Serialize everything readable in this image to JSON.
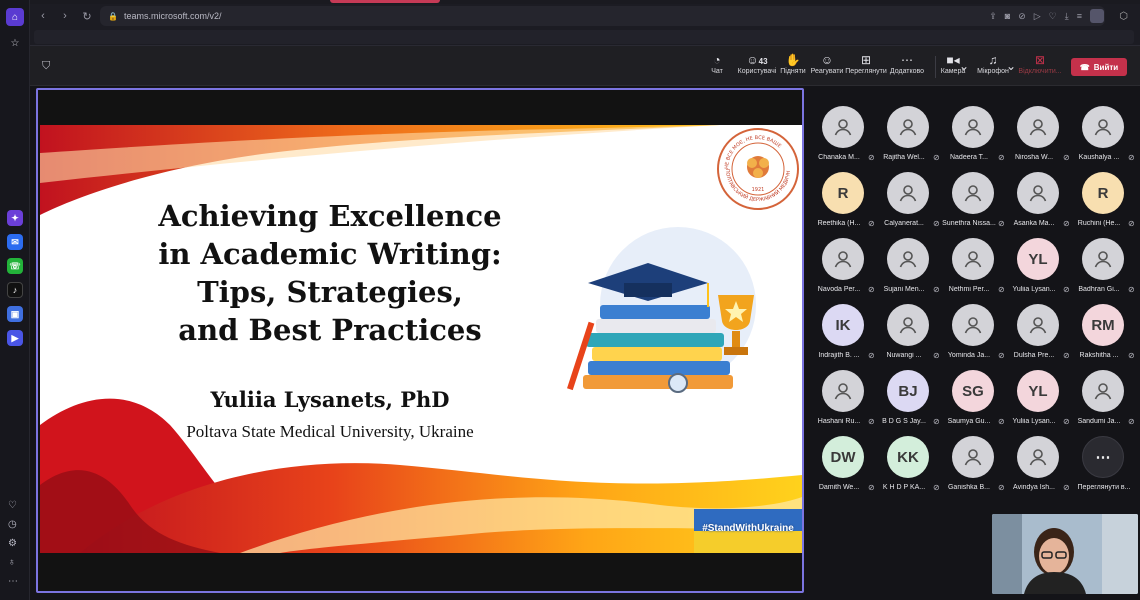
{
  "browser": {
    "url": "teams.microsoft.com/v2/",
    "colors": {
      "accent": "#5a3bd1",
      "tab_active": "#c63a56"
    }
  },
  "toolbar": {
    "chat_label": "Чат",
    "people_label": "Користувачі",
    "people_count": "43",
    "raise_label": "Підняти",
    "react_label": "Реагувати",
    "view_label": "Переглянути",
    "more_label": "Додатково",
    "camera_label": "Камера",
    "mic_label": "Мікрофон",
    "share_label": "Відключити...",
    "leave_label": "Вийти",
    "leave_color": "#c4314b"
  },
  "slide": {
    "title_lines": [
      "Achieving Excellence",
      "in Academic Writing:",
      "Tips, Strategies,",
      "and Best Practices"
    ],
    "author": "Yuliia Lysanets, PhD",
    "affiliation": "Poltava State Medical University, Ukraine",
    "badge": "#StandWithUkraine",
    "seal_text_top": "НЕ ВСЕ МОЄ, НЕ ВСЕ ВАШЕ",
    "seal_year": "1921",
    "seal_text_bottom": "ПОЛТАВСЬКИЙ ДЕРЖАВНИЙ МЕДИЧНИЙ"
  },
  "participants": [
    {
      "name": "Chanaka M...",
      "initials": "",
      "color": ""
    },
    {
      "name": "Rajitha Wel...",
      "initials": "",
      "color": ""
    },
    {
      "name": "Nadeera T...",
      "initials": "",
      "color": ""
    },
    {
      "name": "Nirosha W...",
      "initials": "",
      "color": ""
    },
    {
      "name": "Kaushalya ...",
      "initials": "",
      "color": ""
    },
    {
      "name": "Reethika (H...",
      "initials": "R",
      "color": "#f8dfb0"
    },
    {
      "name": "Calyanerat...",
      "initials": "",
      "color": ""
    },
    {
      "name": "Sunethra Nissa...",
      "initials": "",
      "color": ""
    },
    {
      "name": "Asanka Ma...",
      "initials": "",
      "color": ""
    },
    {
      "name": "Ruchini (He...",
      "initials": "R",
      "color": "#f8dfb0"
    },
    {
      "name": "Navoda Per...",
      "initials": "",
      "color": ""
    },
    {
      "name": "Sujani Men...",
      "initials": "",
      "color": ""
    },
    {
      "name": "Nethmi Per...",
      "initials": "",
      "color": ""
    },
    {
      "name": "Yuliia Lysan...",
      "initials": "YL",
      "color": "#f3d6dc"
    },
    {
      "name": "Badhran Gi...",
      "initials": "",
      "color": ""
    },
    {
      "name": "Indrajith B. ...",
      "initials": "IK",
      "color": "#dcd9f3"
    },
    {
      "name": "Nuwangi ...",
      "initials": "",
      "color": ""
    },
    {
      "name": "Yominda Ja...",
      "initials": "",
      "color": ""
    },
    {
      "name": "Dulsha Pre...",
      "initials": "",
      "color": ""
    },
    {
      "name": "Rakshitha ...",
      "initials": "RM",
      "color": "#f3d6dc"
    },
    {
      "name": "Hashani Ru...",
      "initials": "",
      "color": ""
    },
    {
      "name": "B D G S Jay...",
      "initials": "BJ",
      "color": "#dcd9f3"
    },
    {
      "name": "Saumya Gu...",
      "initials": "SG",
      "color": "#f3d6dc"
    },
    {
      "name": "Yuliia Lysan...",
      "initials": "YL",
      "color": "#f3d6dc"
    },
    {
      "name": "Sandumi Ja...",
      "initials": "",
      "color": ""
    },
    {
      "name": "Damith We...",
      "initials": "DW",
      "color": "#d3eedb"
    },
    {
      "name": "K H D P KA...",
      "initials": "KK",
      "color": "#d3eedb"
    },
    {
      "name": "Ganishka B...",
      "initials": "",
      "color": ""
    },
    {
      "name": "Avindya Ish...",
      "initials": "",
      "color": ""
    }
  ],
  "view_more_label": "Переглянути в...",
  "view_more_glyph": "⋯"
}
